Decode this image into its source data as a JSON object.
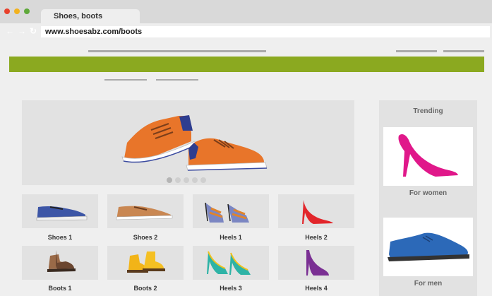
{
  "window": {
    "tab_title": "Shoes, boots",
    "url": "www.shoesabz.com/boots",
    "nav_icons": [
      "back-arrow-icon",
      "forward-arrow-icon",
      "reload-icon"
    ],
    "traffic_light_colors": [
      "#e8412c",
      "#f2b21f",
      "#5fa93a"
    ]
  },
  "page": {
    "accent_color": "#8ba920",
    "carousel": {
      "slides": 5,
      "active_slide": 1
    },
    "products": [
      {
        "label": "Shoes 1"
      },
      {
        "label": "Shoes 2"
      },
      {
        "label": "Heels 1"
      },
      {
        "label": "Heels 2"
      },
      {
        "label": "Boots 1"
      },
      {
        "label": "Boots 2"
      },
      {
        "label": "Heels 3"
      },
      {
        "label": "Heels 4"
      }
    ],
    "sidebar": {
      "title": "Trending",
      "items": [
        {
          "label": "For women"
        },
        {
          "label": "For men"
        }
      ]
    }
  }
}
